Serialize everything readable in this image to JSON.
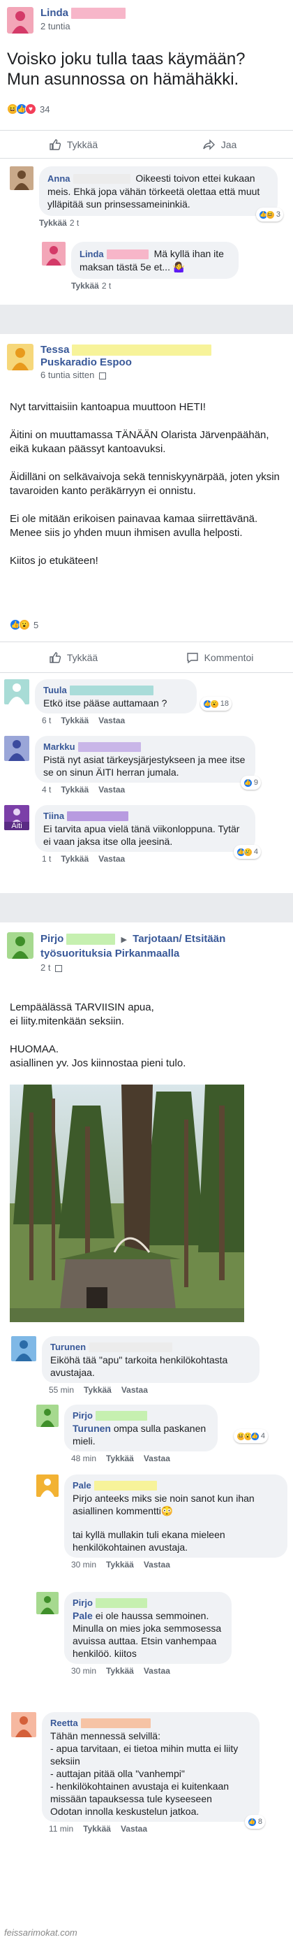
{
  "post1": {
    "author": "Linda",
    "time": "2 tuntia",
    "text_line1": "Voisko joku tulla taas käymään?",
    "text_line2": "Mun asunnossa on hämähäkki.",
    "reaction_count": "34",
    "like_label": "Tykkää",
    "share_label": "Jaa",
    "comments": [
      {
        "name": "Anna",
        "text": "Oikeesti toivon ettei kukaan meis. Ehkä jopa vähän törkeetä olettaa että muut ylläpitää sun prinsessameininkiä.",
        "meta_like": "Tykkää",
        "time": "2 t",
        "react_count": "3"
      },
      {
        "name": "Linda",
        "text": "Mä kyllä ihan ite maksan tästä 5e et... 🤷‍♀️",
        "meta_like": "Tykkää",
        "time": "2 t"
      }
    ]
  },
  "post2": {
    "author": "Tessa",
    "group": "Puskaradio Espoo",
    "time": "6 tuntia sitten",
    "p1": "Nyt tarvittaisiin kantoapua muuttoon HETI!",
    "p2": "Äitini on muuttamassa TÄNÄÄN Olarista Järvenpäähän, eikä kukaan päässyt kantoavuksi.",
    "p3": "Äidilläni on selkävaivoja sekä tenniskyynärpää, joten yksin tavaroiden kanto peräkärryyn ei onnistu.",
    "p4": "Ei ole mitään erikoisen painavaa kamaa siirrettävänä.",
    "p5": "Menee siis jo yhden muun ihmisen avulla helposti.",
    "p6": "Kiitos jo etukäteen!",
    "reaction_count": "5",
    "like_label": "Tykkää",
    "comment_label": "Kommentoi",
    "comments": [
      {
        "name": "Tuula",
        "text": "Etkö itse pääse auttamaan ?",
        "time": "6 t",
        "like": "Tykkää",
        "reply": "Vastaa",
        "react_count": "18"
      },
      {
        "name": "Markku",
        "text": "Pistä nyt asiat tärkeysjärjestykseen ja mee itse se on sinun ÄITI herran jumala.",
        "time": "4 t",
        "like": "Tykkää",
        "reply": "Vastaa",
        "react_count": "9"
      },
      {
        "name": "Tiina",
        "avatar_text": "Äiti",
        "text": "Ei tarvita apua vielä tänä viikonloppuna. Tytär ei vaan jaksa itse olla jeesinä.",
        "time": "1 t",
        "like": "Tykkää",
        "reply": "Vastaa",
        "react_count": "4"
      }
    ]
  },
  "post3": {
    "author": "Pirjo",
    "arrow": "▶",
    "group": "Tarjotaan/ Etsitään työsuorituksia Pirkanmaalla",
    "time": "2 t",
    "p1": "Lempäälässä TARVIISIN apua,",
    "p2": "ei liity.mitenkään seksiin.",
    "p3": "HUOMAA.",
    "p4": "asiallinen yv. Jos kiinnostaa pieni tulo.",
    "comments": [
      {
        "name": "Turunen",
        "text": "Eiköhä tää \"apu\" tarkoita henkilökohtasta avustajaa.",
        "time": "55 min",
        "like": "Tykkää",
        "reply": "Vastaa"
      },
      {
        "name": "Pirjo",
        "mention": "Turunen",
        "text": "ompa sulla paskanen mieli.",
        "time": "48 min",
        "like": "Tykkää",
        "reply": "Vastaa",
        "react_count": "4"
      },
      {
        "name": "Pale",
        "text1": "Pirjo anteeks miks sie noin sanot kun ihan asiallinen kommentti😳",
        "text2": "tai kyllä mullakin tuli ekana mieleen henkilökohtainen avustaja.",
        "time": "30 min",
        "like": "Tykkää",
        "reply": "Vastaa"
      },
      {
        "name": "Pirjo",
        "mention": "Pale",
        "text": "ei ole haussa semmoinen. Minulla on mies joka semmosessa avuissa auttaa. Etsin vanhempaa henkilöö. kiitos",
        "time": "30 min",
        "like": "Tykkää",
        "reply": "Vastaa"
      },
      {
        "name": "Reetta",
        "text0": "Tähän mennessä selvillä:",
        "b1": "- apua tarvitaan, ei tietoa mihin mutta ei liity seksiin",
        "b2": "- auttajan pitää olla \"vanhempi\"",
        "b3": "- henkilökohtainen avustaja ei kuitenkaan missään tapauksessa tule kyseeseen",
        "b4": "Odotan innolla keskustelun jatkoa.",
        "time": "11 min",
        "like": "Tykkää",
        "reply": "Vastaa",
        "react_count": "8"
      }
    ]
  },
  "watermark": "feissarimokat.com",
  "colors": {
    "link": "#385898",
    "pink_highlight": "#f7b6c9",
    "yellow_highlight": "#f7f39a",
    "teal_highlight": "#a9dcd9",
    "lilac_highlight": "#c9b6e8",
    "purple_highlight": "#b89be0",
    "green_highlight": "#c6f0b0",
    "salmon_highlight": "#f6c3a5"
  }
}
